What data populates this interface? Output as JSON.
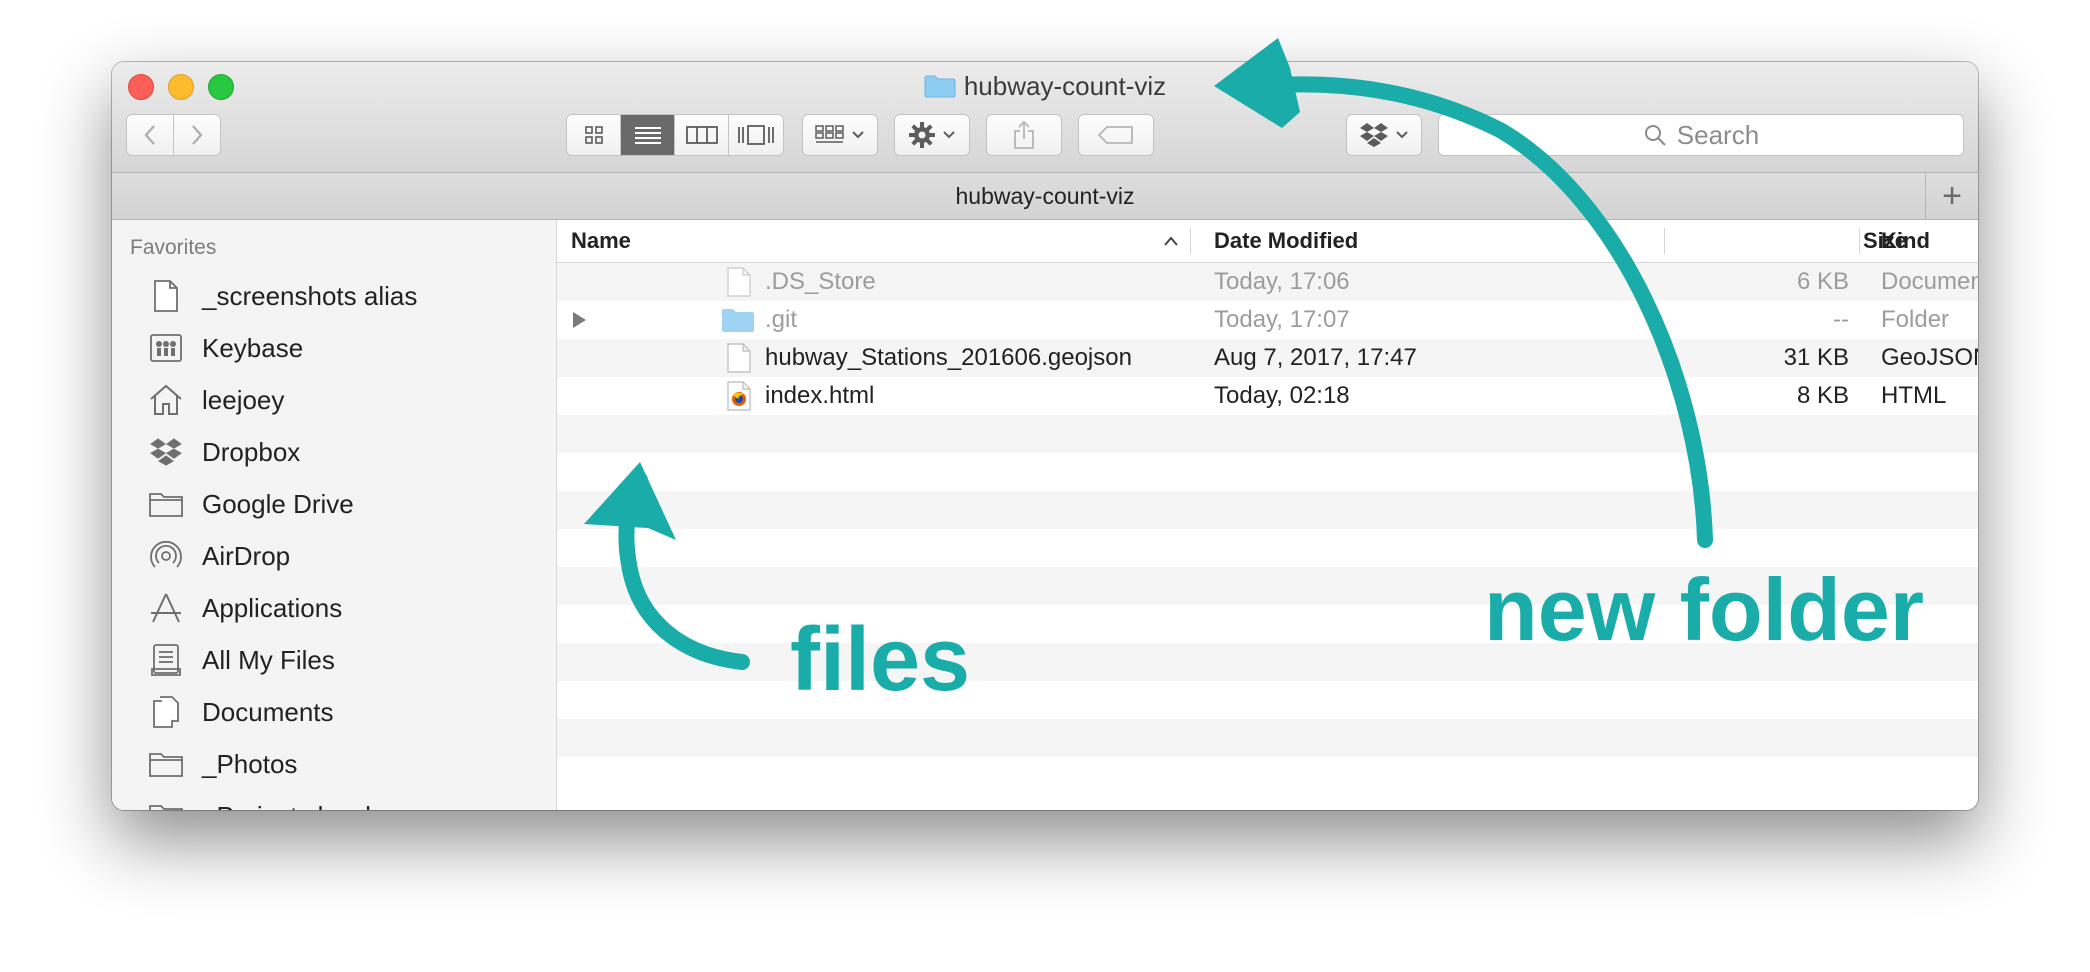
{
  "window": {
    "title": "hubway-count-viz",
    "path_bar_title": "hubway-count-viz"
  },
  "toolbar": {
    "search_placeholder": "Search",
    "view_modes": [
      "icon-view",
      "list-view",
      "column-view",
      "cover-flow-view"
    ],
    "active_view": "list-view"
  },
  "sidebar": {
    "heading": "Favorites",
    "items": [
      {
        "label": "_screenshots alias",
        "icon": "document-icon"
      },
      {
        "label": "Keybase",
        "icon": "keybase-drive-icon"
      },
      {
        "label": "leejoey",
        "icon": "home-icon"
      },
      {
        "label": "Dropbox",
        "icon": "dropbox-icon"
      },
      {
        "label": "Google Drive",
        "icon": "folder-icon"
      },
      {
        "label": "AirDrop",
        "icon": "airdrop-icon"
      },
      {
        "label": "Applications",
        "icon": "applications-icon"
      },
      {
        "label": "All My Files",
        "icon": "all-files-icon"
      },
      {
        "label": "Documents",
        "icon": "documents-icon"
      },
      {
        "label": "_Photos",
        "icon": "folder-icon"
      },
      {
        "label": "_Projects local",
        "icon": "folder-icon"
      }
    ]
  },
  "columns": {
    "name": "Name",
    "date_modified": "Date Modified",
    "size": "Size",
    "kind": "Kind"
  },
  "files": [
    {
      "name": ".DS_Store",
      "date": "Today, 17:06",
      "size": "6 KB",
      "kind": "Document",
      "icon": "document-icon"
    },
    {
      "name": ".git",
      "date": "Today, 17:07",
      "size": "--",
      "kind": "Folder",
      "icon": "folder-icon"
    },
    {
      "name": "hubway_Stations_201606.geojson",
      "date": "Aug 7, 2017, 17:47",
      "size": "31 KB",
      "kind": "GeoJSON File",
      "icon": "document-icon"
    },
    {
      "name": "index.html",
      "date": "Today, 02:18",
      "size": "8 KB",
      "kind": "HTML",
      "icon": "firefox-html-icon"
    }
  ],
  "annotations": {
    "files_label": "files",
    "new_folder_label": "new folder"
  },
  "colors": {
    "annotation": "#1aaca8",
    "close": "#fc5f57",
    "minimize": "#fdbb2e",
    "maximize": "#28c840",
    "folder": "#8ecdf3"
  }
}
